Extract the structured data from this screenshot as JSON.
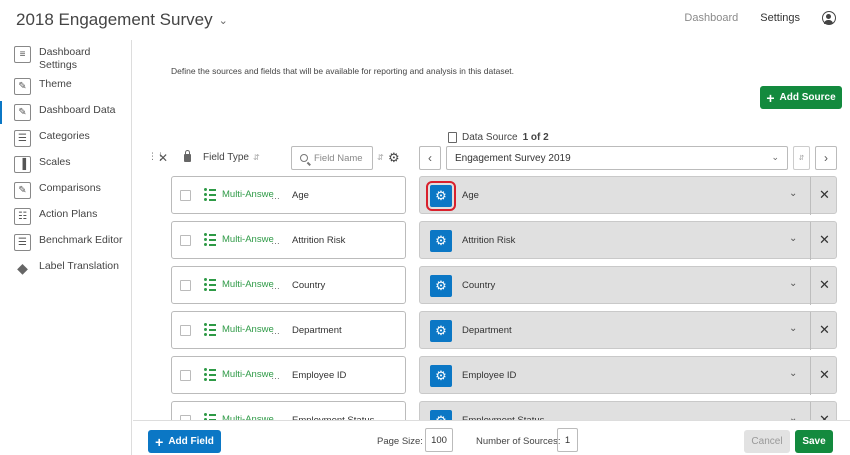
{
  "header": {
    "title": "2018 Engagement Survey",
    "nav": {
      "dashboard": "Dashboard",
      "settings": "Settings"
    }
  },
  "sidebar": {
    "items": [
      {
        "label": "Dashboard\nSettings",
        "icon": "sliders-icon",
        "active": false
      },
      {
        "label": "Theme",
        "icon": "paintbrush-icon",
        "active": false
      },
      {
        "label": "Dashboard Data",
        "icon": "pencil-icon",
        "active": true
      },
      {
        "label": "Categories",
        "icon": "list-icon",
        "active": false
      },
      {
        "label": "Scales",
        "icon": "bar-chart-icon",
        "active": false
      },
      {
        "label": "Comparisons",
        "icon": "pencil-icon",
        "active": false
      },
      {
        "label": "Action Plans",
        "icon": "clipboard-icon",
        "active": false
      },
      {
        "label": "Benchmark Editor",
        "icon": "list-icon",
        "active": false
      },
      {
        "label": "Label Translation",
        "icon": "tag-icon",
        "active": false
      }
    ]
  },
  "main": {
    "intro": "Define the sources and fields that will be available for reporting and analysis in this dataset.",
    "add_source": "Add Source",
    "data_source_label": "Data Source",
    "data_source_count": "1 of 2",
    "field_type_header": "Field Type",
    "search_placeholder": "Field Name",
    "selected_source": "Engagement Survey 2019",
    "rows": [
      {
        "type": "Multi-Answe",
        "field": "Age",
        "mapped": "Age"
      },
      {
        "type": "Multi-Answe",
        "field": "Attrition Risk",
        "mapped": "Attrition Risk"
      },
      {
        "type": "Multi-Answe",
        "field": "Country",
        "mapped": "Country"
      },
      {
        "type": "Multi-Answe",
        "field": "Department",
        "mapped": "Department"
      },
      {
        "type": "Multi-Answe",
        "field": "Employee ID",
        "mapped": "Employee ID"
      },
      {
        "type": "Multi-Answe",
        "field": "Employment Status",
        "mapped": "Employment Status"
      }
    ]
  },
  "footer": {
    "add_field": "Add Field",
    "page_size_label": "Page Size:",
    "page_size": "100",
    "sources_label": "Number of Sources:",
    "sources": "1",
    "cancel": "Cancel",
    "save": "Save"
  },
  "colors": {
    "accent_blue": "#0b77c5",
    "save_green": "#138a3e",
    "type_green": "#2e9a46",
    "highlight_red": "#d9202c"
  }
}
